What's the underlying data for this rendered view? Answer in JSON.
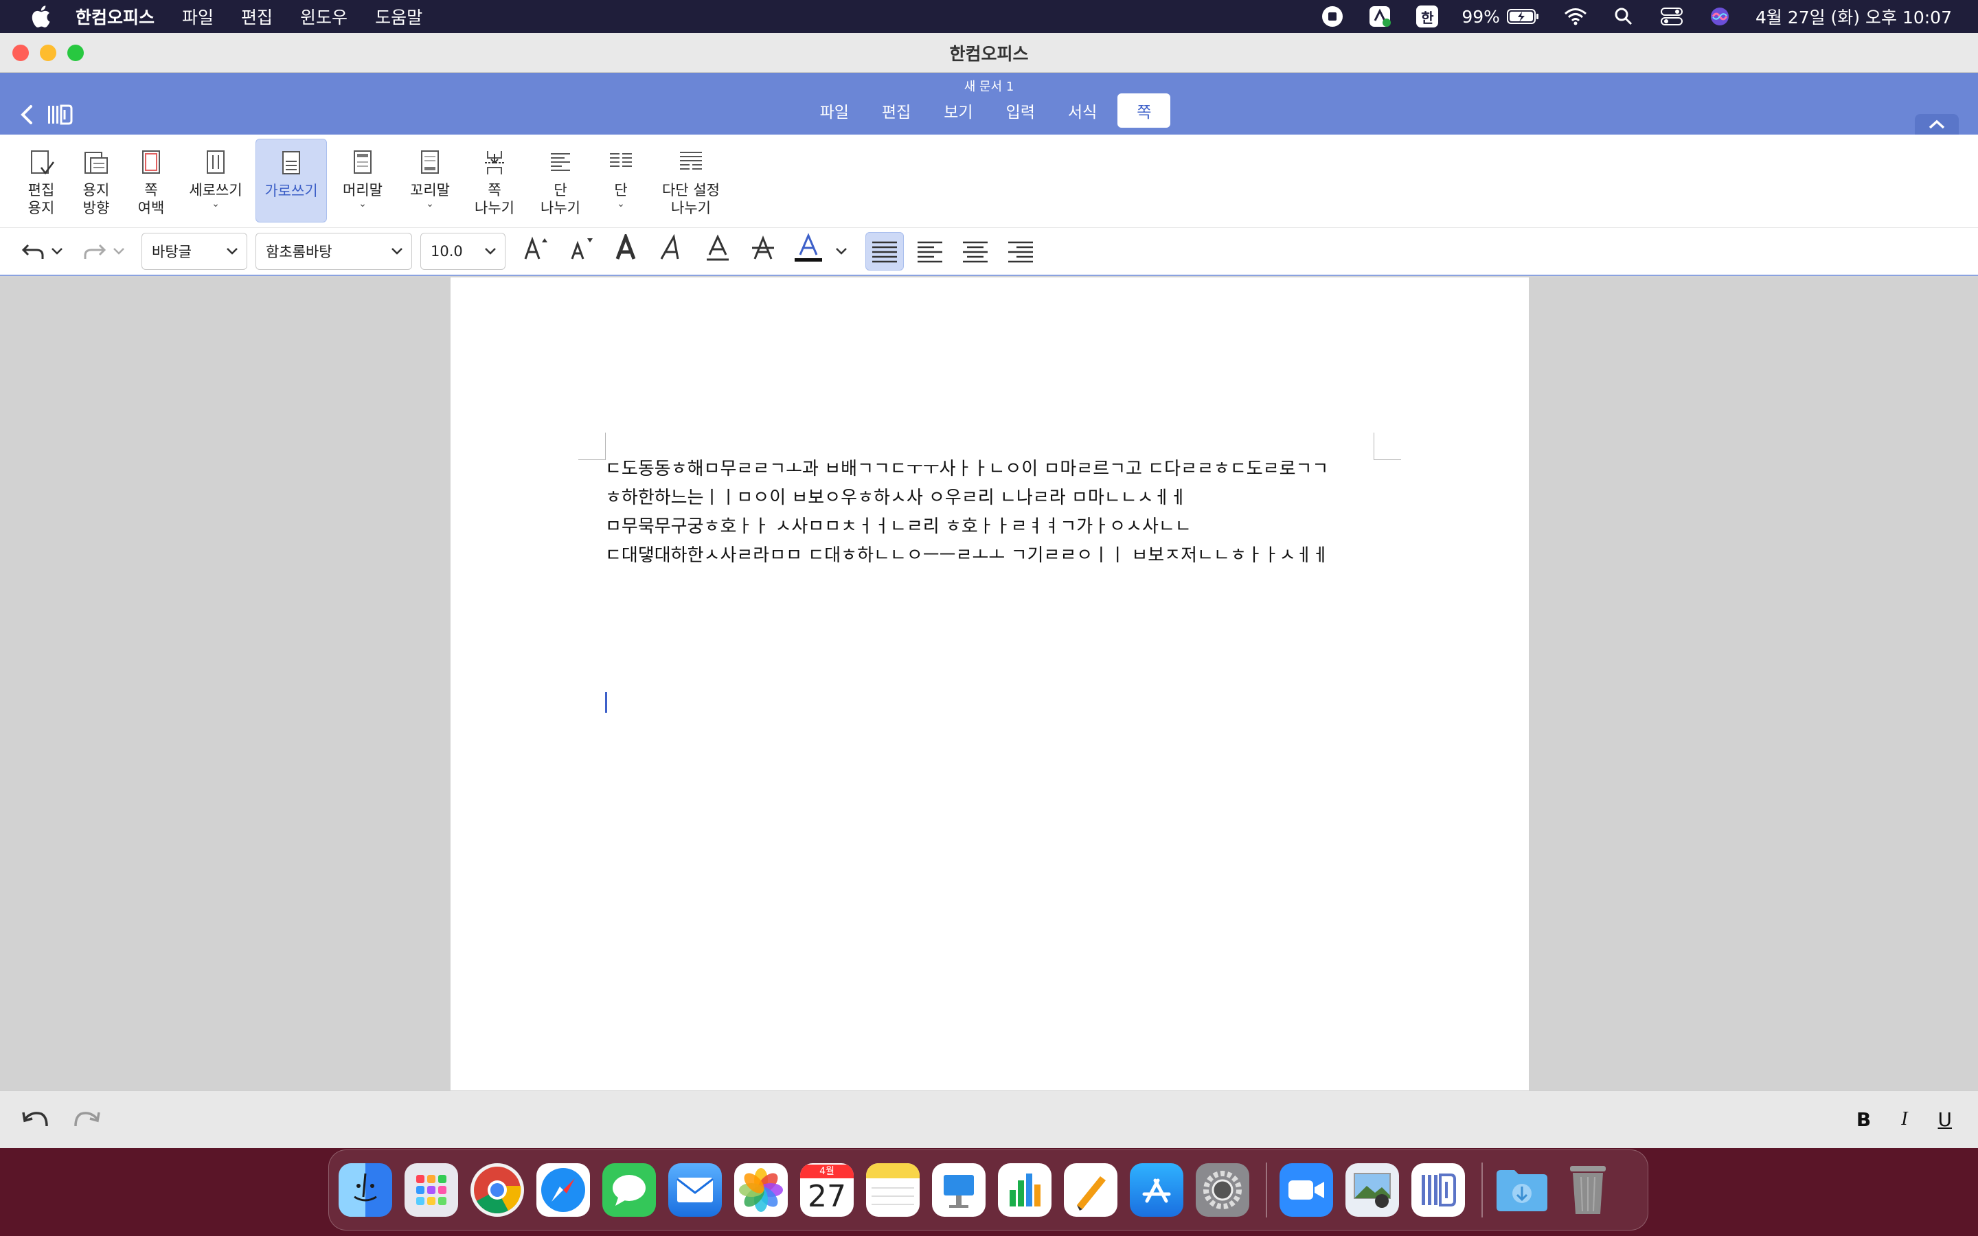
{
  "menubar": {
    "app_name": "한컴오피스",
    "items": [
      "파일",
      "편집",
      "윈도우",
      "도움말"
    ],
    "battery": "99%",
    "ime": "한",
    "datetime": "4월 27일 (화) 오후 10:07"
  },
  "window": {
    "title": "한컴오피스",
    "doc_name": "새 문서 1",
    "tabs": [
      "파일",
      "편집",
      "보기",
      "입력",
      "서식",
      "쪽"
    ],
    "active_tab": "쪽"
  },
  "ribbon": {
    "edit_paper": [
      "편집",
      "용지"
    ],
    "paper_dir": [
      "용지",
      "방향"
    ],
    "page_margin": [
      "쪽",
      "여백"
    ],
    "vertical": "세로쓰기",
    "horizontal": "가로쓰기",
    "header": "머리말",
    "footer": "꼬리말",
    "page_break": [
      "쪽",
      "나누기"
    ],
    "col_break": [
      "단",
      "나누기"
    ],
    "column": "단",
    "multi_col": [
      "다단 설정",
      "나누기"
    ]
  },
  "format": {
    "style": "바탕글",
    "font": "함초롬바탕",
    "size": "10.0"
  },
  "document": {
    "lines": [
      "ㄷ도동동ㅎ해ㅁ무ㄹㄹㄱㅗ과 ㅂ배ㄱㄱㄷㅜㅜ사ㅏㅏㄴㅇ이 ㅁ마ㄹ르ㄱ고 ㄷ다ㄹㄹㅎㄷ도ㄹ로ㄱㄱ",
      "ㅎ하한하느는ㅣㅣㅁㅇ이 ㅂ보ㅇ우ㅎ하ㅅ사 ㅇ우ㄹ리 ㄴ나ㄹ라 ㅁ마ㄴㄴㅅㅔㅔ",
      "ㅁ무묵무구궁ㅎ호ㅏㅏ ㅅ사ㅁㅁㅊㅓㅓㄴㄹ리 ㅎ호ㅏㅏㄹㅕㅕㄱ가ㅏㅇㅅ사ㄴㄴ",
      "ㄷ대댛대하한ㅅ사ㄹ라ㅁㅁ ㄷ대ㅎ하ㄴㄴㅇㅡㅡㄹㅗㅗ ㄱ기ㄹㄹㅇㅣㅣ ㅂ보ㅈ저ㄴㄴㅎㅏㅏㅅㅔㅔ"
    ]
  },
  "bottombar": {
    "bold": "B",
    "italic": "I",
    "underline": "U"
  },
  "dock": {
    "calendar_month": "4월",
    "calendar_day": "27"
  },
  "colors": {
    "accent": "#6b86d6",
    "active_blue": "#3d60c9",
    "menubar": "#1f1e3a",
    "desktop": "#5a1528"
  }
}
